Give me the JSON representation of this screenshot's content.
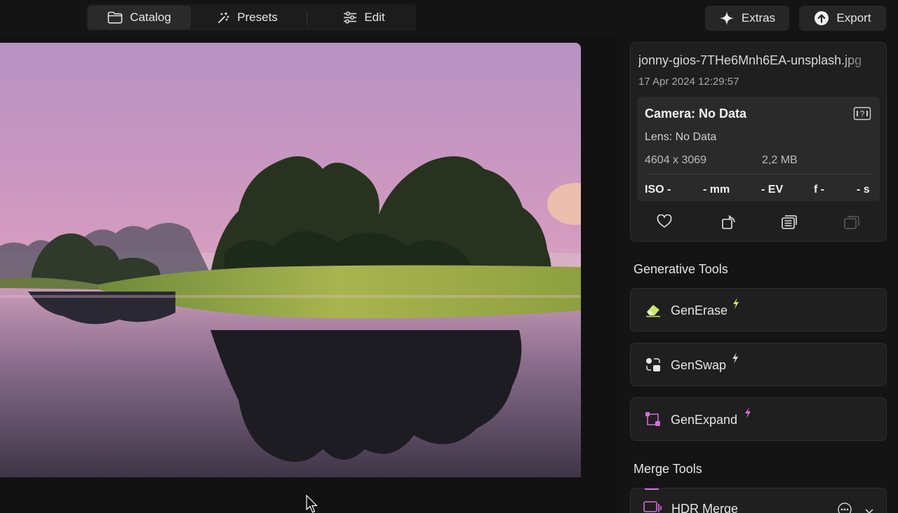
{
  "nav": {
    "tabs": [
      {
        "label": "Catalog",
        "icon": "folder-icon",
        "active": true
      },
      {
        "label": "Presets",
        "icon": "magic-wand-icon",
        "active": false
      },
      {
        "label": "Edit",
        "icon": "sliders-icon",
        "active": false
      }
    ]
  },
  "toolbar": {
    "extras_label": "Extras",
    "export_label": "Export"
  },
  "info": {
    "filename": "jonny-gios-7THe6Mnh6EA-unsplash.jpg",
    "date": "17 Apr 2024 12:29:57",
    "camera": "Camera: No Data",
    "lens": "Lens: No Data",
    "dimensions": "4604 x 3069",
    "filesize": "2,2 MB",
    "exif": {
      "iso": "ISO -",
      "focal": "- mm",
      "ev": "- EV",
      "aperture": "f -",
      "shutter": "- s"
    }
  },
  "sections": {
    "generative_title": "Generative Tools",
    "merge_title": "Merge Tools"
  },
  "tools": {
    "generase": "GenErase",
    "genswap": "GenSwap",
    "genexpand": "GenExpand",
    "hdr": "HDR Merge"
  },
  "colors": {
    "accent_green": "#c8e86a",
    "accent_pink": "#d46fd9",
    "panel_bg": "#1f1f1f"
  }
}
